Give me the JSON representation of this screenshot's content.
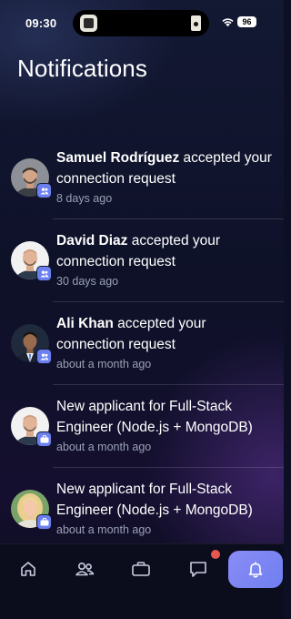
{
  "status_bar": {
    "time": "09:30",
    "battery": "96",
    "icons": [
      "wifi-icon",
      "battery-icon"
    ]
  },
  "header": {
    "title": "Notifications"
  },
  "notifications": [
    {
      "name": "Samuel Rodríguez",
      "message": " accepted your connection request",
      "time": "8 days ago",
      "badge_icon": "people-icon"
    },
    {
      "name": "David Diaz",
      "message": " accepted your connection request",
      "time": "30 days ago",
      "badge_icon": "people-icon"
    },
    {
      "name": "Ali Khan",
      "message": " accepted your connection request",
      "time": "about a month ago",
      "badge_icon": "people-icon"
    },
    {
      "name": "",
      "message": "New applicant for Full-Stack Engineer (Node.js + MongoDB)",
      "time": "about a month ago",
      "badge_icon": "briefcase-icon"
    },
    {
      "name": "",
      "message": "New applicant for Full-Stack Engineer (Node.js + MongoDB)",
      "time": "about a month ago",
      "badge_icon": "briefcase-icon"
    }
  ],
  "bottom_nav": {
    "items": [
      "home-icon",
      "people-icon",
      "briefcase-icon",
      "chat-icon",
      "bell-icon"
    ],
    "active": "bell-icon",
    "unread_dot_on": "chat-icon"
  },
  "colors": {
    "accent": "#6f7ff0",
    "badge": "#6b7ff0",
    "unread_dot": "#e8574f",
    "muted_text": "#9aa0b4"
  }
}
